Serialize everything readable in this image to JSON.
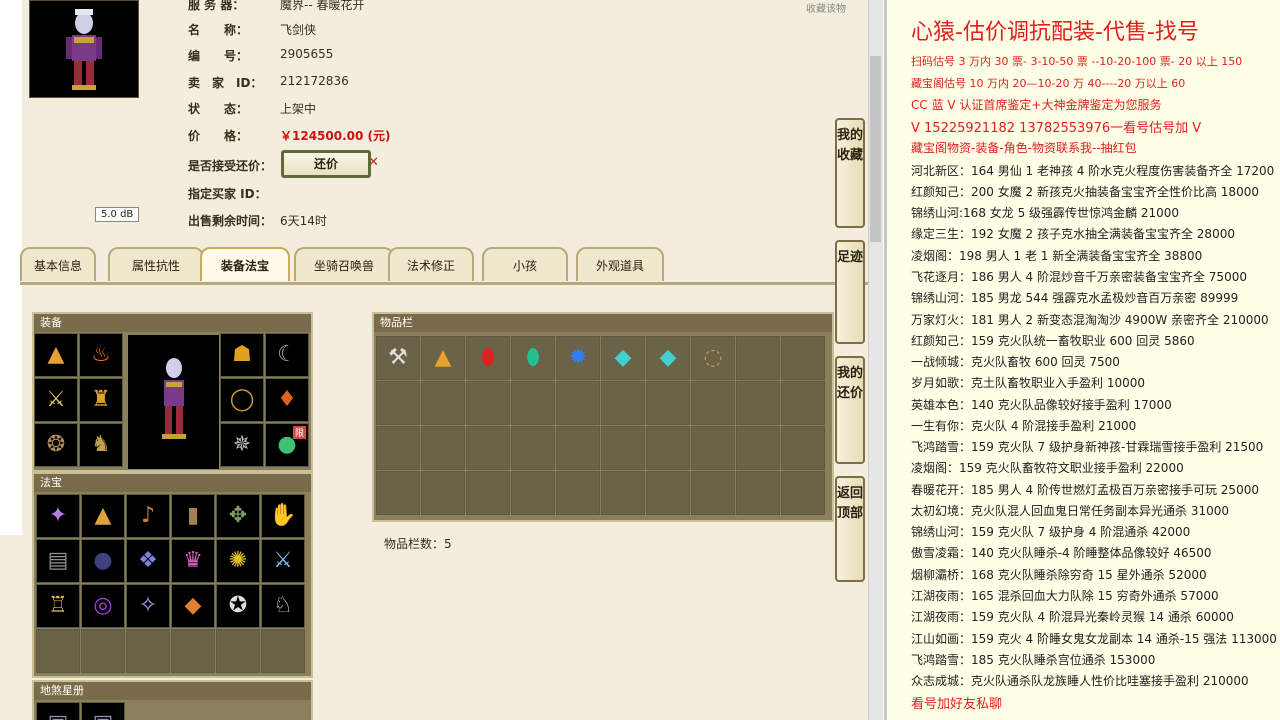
{
  "header": {
    "server_label": "服 务 器：",
    "server_value": "魔界-- 春暖花开",
    "fav_link": "收藏该物"
  },
  "info": [
    {
      "label": "名　　称：",
      "value": "飞剑侠"
    },
    {
      "label": "编　　号：",
      "value": "2905655"
    },
    {
      "label": "卖　家　ID：",
      "value": "212172836"
    },
    {
      "label": "状　　态：",
      "value": "上架中"
    },
    {
      "label": "价　　格：",
      "value": "￥124500.00 (元)"
    },
    {
      "label": "是否接受还价：",
      "value": ""
    },
    {
      "label": "指定买家 ID：",
      "value": ""
    },
    {
      "label": "出售剩余时间：",
      "value": "6天14时"
    }
  ],
  "haggle_button": "还价",
  "tooltip": "5.0 dB",
  "tabs": [
    "基本信息",
    "属性抗性",
    "装备法宝",
    "坐骑召唤兽",
    "法术修正",
    "小孩",
    "外观道具"
  ],
  "active_tab": "装备法宝",
  "side_buttons": [
    "我的收藏",
    "足迹",
    "我的还价",
    "返回顶部"
  ],
  "panels": {
    "equip": "装备",
    "fabao": "法宝",
    "dishao": "地煞星册",
    "bag": "物品栏"
  },
  "equip_icons": [
    "hat-icon",
    "flame-icon",
    "dagger-icon",
    "robe-icon",
    "whip-icon",
    "boots-icon"
  ],
  "equip_right_icons": [
    "beast-mask-icon",
    "bow-icon",
    "ring-icon",
    "amulet-icon",
    "gem-belt-icon",
    "green-orb-icon"
  ],
  "limit_badge": "限",
  "fabao_icons": [
    "lamp-icon",
    "crystal-icon",
    "lute-icon",
    "tablet-icon",
    "cactus-icon",
    "glove-icon",
    "scroll-icon",
    "dark-orb-icon",
    "fan-icon",
    "lantern-icon",
    "golden-cloud-icon",
    "sword-icon",
    "pagoda-icon",
    "purple-ring-icon",
    "spark-icon",
    "slice-icon",
    "mirror-icon",
    "dragon-icon"
  ],
  "bag_icons": [
    "axe-icon",
    "hat-icon",
    "red-gem-icon",
    "green-gem-icon",
    "blue-gem-icon",
    "cyan-stone-icon",
    "cyan-stone-2-icon",
    "necklace-icon"
  ],
  "bag_count": "物品栏数：5",
  "right": {
    "title": "心猿-估价调抗配装-代售-找号",
    "lines": [
      {
        "text": "扫码估号 3 万内 30 票- 3-10-50 票  --10-20-100 票- 20 以上 150",
        "style": "red small"
      },
      {
        "text": "藏宝阁估号 10 万内 20—10-20 万 40----20 万以上 60",
        "style": "red small"
      },
      {
        "text": "CC 蓝 V 认证首席鉴定+大神金牌鉴定为您服务",
        "style": "red"
      },
      {
        "text": "V 15225921182     13782553976一看号估号加 V",
        "style": "red med"
      },
      {
        "text": "藏宝阁物资-装备-角色-物资联系我--抽红包",
        "style": "red"
      },
      {
        "text": "河北新区：164 男仙 1 老神孩 4 阶水克火程度伤害装备齐全 17200",
        "style": ""
      },
      {
        "text": "红颜知己：200 女魔 2 新孩克火抽装备宝宝齐全性价比高 18000",
        "style": ""
      },
      {
        "text": "锦绣山河:168 女龙 5 级强霹传世惊鸿金麟 21000",
        "style": ""
      },
      {
        "text": "缘定三生：192 女魔 2 孩子克水抽全满装备宝宝齐全 28000",
        "style": ""
      },
      {
        "text": "凌烟阁：198 男人 1 老 1 新全满装备宝宝齐全 38800",
        "style": ""
      },
      {
        "text": "飞花逐月：186 男人 4 阶混炒音千万亲密装备宝宝齐全 75000",
        "style": ""
      },
      {
        "text": "锦绣山河：185 男龙 544 强霹克水孟极炒音百万亲密 89999",
        "style": ""
      },
      {
        "text": "万家灯火：181 男人 2 新变态混淘淘沙 4900W 亲密齐全 210000",
        "style": ""
      },
      {
        "text": "红颜知己：159 克火队统一畜牧职业 600 回灵 5860",
        "style": ""
      },
      {
        "text": "一战倾城：克火队畜牧 600 回灵 7500",
        "style": ""
      },
      {
        "text": "岁月如歌：克土队畜牧职业入手盈利 10000",
        "style": ""
      },
      {
        "text": "英雄本色：140 克火队品像较好接手盈利 17000",
        "style": ""
      },
      {
        "text": "一生有你：克火队 4 阶混接手盈利 21000",
        "style": ""
      },
      {
        "text": "飞鸿踏雪：159 克火队 7 级护身新神孩-甘霖瑞雪接手盈利 21500",
        "style": ""
      },
      {
        "text": "凌烟阁：159 克火队畜牧符文职业接手盈利 22000",
        "style": ""
      },
      {
        "text": "春暖花开：185 男人 4 阶传世燃灯孟极百万亲密接手可玩 25000",
        "style": ""
      },
      {
        "text": "太初幻境：克火队混人回血鬼日常任务副本异光通杀 31000",
        "style": ""
      },
      {
        "text": "锦绣山河：159 克火队 7 级护身 4 阶混通杀 42000",
        "style": ""
      },
      {
        "text": "傲雪凌霜：140 克火队睡杀-4 阶睡整体品像较好 46500",
        "style": ""
      },
      {
        "text": "烟柳灞桥：168 克火队睡杀除穷奇 15 星外通杀 52000",
        "style": ""
      },
      {
        "text": "江湖夜雨：165 混杀回血大力队除 15 穷奇外通杀 57000",
        "style": ""
      },
      {
        "text": "江湖夜雨：159 克火队 4 阶混异光秦岭灵猴 14 通杀 60000",
        "style": ""
      },
      {
        "text": "江山如画：159 克火 4 阶睡女鬼女龙副本 14 通杀-15 强法 113000",
        "style": ""
      },
      {
        "text": "飞鸿踏雪：185 克火队睡杀宫位通杀 153000",
        "style": ""
      },
      {
        "text": "众志成城：克火队通杀队龙族睡人性价比哇塞接手盈利 210000",
        "style": ""
      },
      {
        "text": "看号加好友私聊",
        "style": "red med"
      }
    ]
  }
}
